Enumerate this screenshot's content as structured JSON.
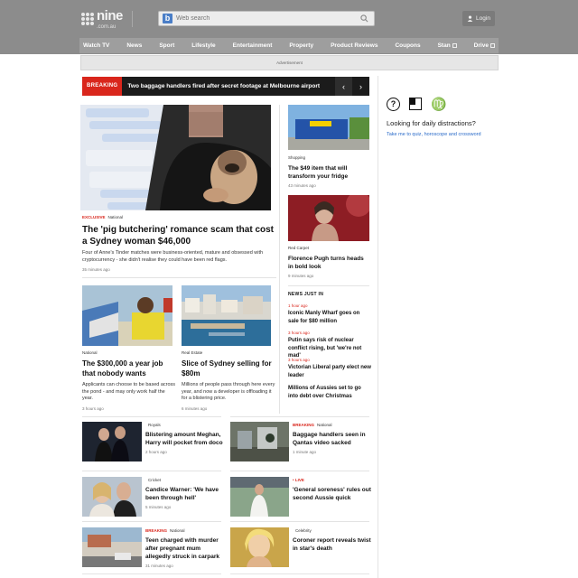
{
  "header": {
    "logo_text": "nine",
    "logo_sub": ".com.au",
    "search_placeholder": "Web search",
    "login_label": "Login"
  },
  "nav": [
    "Watch TV",
    "News",
    "Sport",
    "Lifestyle",
    "Entertainment",
    "Property",
    "Product Reviews",
    "Coupons",
    "Stan",
    "Drive"
  ],
  "ad_label": "Advertisement",
  "breaking": {
    "tag": "BREAKING",
    "text": "Two baggage handlers fired after secret footage at Melbourne airport"
  },
  "lead": {
    "kicker_tag": "EXCLUSIVE",
    "kicker": "National",
    "headline": "The 'pig butchering' romance scam that cost a Sydney woman $46,000",
    "summary": "Four of Anne's Tinder matches were business-oriented, mature and obsessed with cryptocurrency - she didn't realise they could have been red flags.",
    "time": "35 minutes ago"
  },
  "mid_stories": [
    {
      "kicker": "National",
      "headline": "The $300,000 a year job that nobody wants",
      "summary": "Applicants can choose to be based across the pond - and may only work half the year.",
      "time": "3 hours ago"
    },
    {
      "kicker": "Real Estate",
      "headline": "Slice of Sydney selling for $80m",
      "summary": "Millions of people pass through here every year, and now a developer is offloading it for a blistering price.",
      "time": "6 minutes ago"
    }
  ],
  "side_stories": [
    {
      "kicker": "Shopping",
      "headline": "The $49 item that will transform your fridge",
      "time": "43 minutes ago"
    },
    {
      "kicker": "Red Carpet",
      "headline": "Florence Pugh turns heads in bold look",
      "time": "9 minutes ago"
    }
  ],
  "news_just_in": {
    "title": "NEWS JUST IN",
    "items": [
      {
        "time": "1 hour ago",
        "headline": "Iconic Manly Wharf goes on sale for $80 million"
      },
      {
        "time": "3 hours ago",
        "headline": "Putin says risk of nuclear conflict rising, but 'we're not mad'"
      },
      {
        "time": "3 hours ago",
        "headline": "Victorian Liberal party elect new leader"
      },
      {
        "time": "",
        "headline": "Millions of Aussies set to go into debt over Christmas"
      }
    ]
  },
  "rail": {
    "icon_quiz": "?",
    "icon_zodiac": "♍",
    "title": "Looking for daily distractions?",
    "link": "Take me to quiz, horoscope and crossword"
  },
  "grid_stories": [
    {
      "kicker_tag": "",
      "kicker": "Royals",
      "headline": "Blistering amount Meghan, Harry will pocket from doco",
      "time": "2 hours ago"
    },
    {
      "kicker_tag": "BREAKING",
      "kicker": "National",
      "headline": "Baggage handlers seen in Qantas video sacked",
      "time": "1 minute ago"
    },
    {
      "kicker_tag": "",
      "kicker": "Cricket",
      "headline": "Candice Warner: 'We have been through hell'",
      "time": "5 minutes ago"
    },
    {
      "kicker_tag": "• LIVE",
      "kicker": "",
      "headline": "'General soreness' rules out second Aussie quick",
      "time": ""
    },
    {
      "kicker_tag": "BREAKING",
      "kicker": "National",
      "headline": "Teen charged with murder after pregnant mum allegedly struck in carpark",
      "time": "31 minutes ago"
    },
    {
      "kicker_tag": "",
      "kicker": "Celebrity",
      "headline": "Coroner report reveals twist in star's death",
      "time": ""
    }
  ],
  "colors": {
    "accent_red": "#d9261c",
    "link_blue": "#2a6bc9",
    "header_grey": "#8c8c8c"
  }
}
